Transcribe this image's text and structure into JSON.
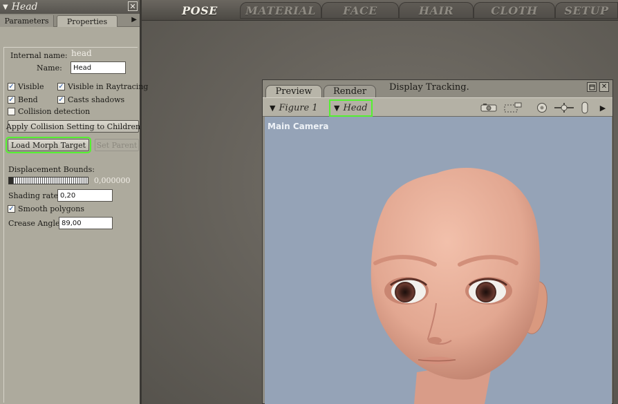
{
  "top_tabs": [
    "POSE",
    "MATERIAL",
    "FACE",
    "HAIR",
    "CLOTH",
    "SETUP"
  ],
  "panel": {
    "title": "Head",
    "close": "✕",
    "tabs": {
      "parameters": "Parameters",
      "properties": "Properties"
    },
    "internal_name_label": "Internal name:",
    "internal_name_value": "head",
    "name_label": "Name:",
    "name_value": "Head",
    "checkboxes": {
      "visible": {
        "label": "Visible",
        "checked": true
      },
      "visible_raytracing": {
        "label": "Visible in Raytracing",
        "checked": true
      },
      "bend": {
        "label": "Bend",
        "checked": true
      },
      "casts_shadows": {
        "label": "Casts shadows",
        "checked": true
      },
      "collision_detection": {
        "label": "Collision detection",
        "checked": false
      },
      "smooth_polygons": {
        "label": "Smooth polygons",
        "checked": true
      }
    },
    "apply_collision_button": "Apply Collision Setting to Children",
    "load_morph_button": "Load Morph Target",
    "set_parent_button": "Set Parent",
    "displacement_label": "Displacement Bounds:",
    "displacement_value": "0,000000",
    "shading_rate_label": "Shading rate:",
    "shading_rate_value": "0,20",
    "crease_angle_label": "Crease Angle",
    "crease_angle_value": "89,00"
  },
  "preview": {
    "tabs": {
      "preview": "Preview",
      "render": "Render"
    },
    "tracking": "Display Tracking.",
    "figure_select": "Figure 1",
    "actor_select": "Head",
    "camera_label": "Main Camera"
  },
  "colors": {
    "highlight": "#54f030",
    "skin": "#e7ab96",
    "viewport_bg": "#95a3b7"
  }
}
